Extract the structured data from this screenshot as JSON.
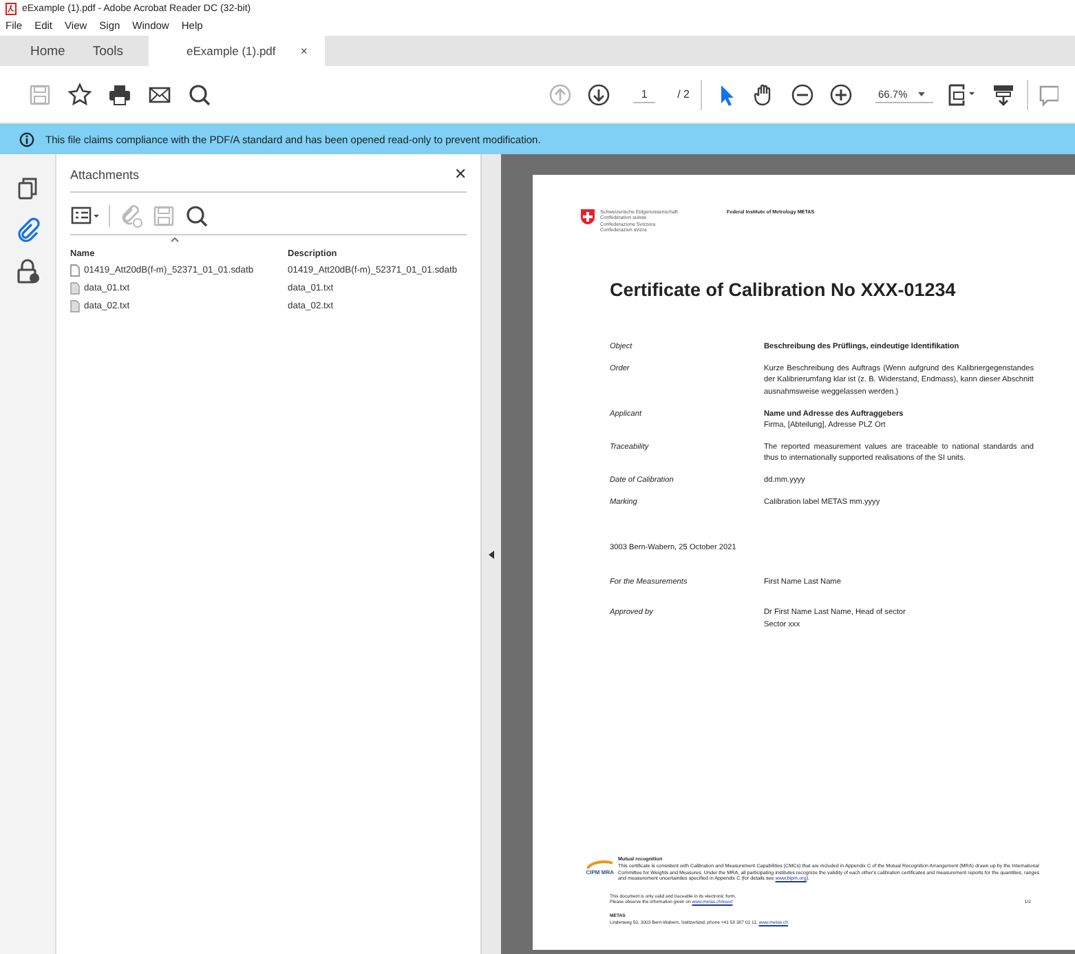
{
  "window": {
    "title": "eExample (1).pdf - Adobe Acrobat Reader DC (32-bit)"
  },
  "menu": [
    "File",
    "Edit",
    "View",
    "Sign",
    "Window",
    "Help"
  ],
  "tabs": [
    {
      "label": "Home",
      "selected": false
    },
    {
      "label": "Tools",
      "selected": false
    },
    {
      "label": "eExample (1).pdf",
      "selected": true,
      "close": "×"
    }
  ],
  "toolbar": {
    "file_tools": [
      {
        "kind": "save",
        "disabled": true
      },
      {
        "kind": "star",
        "disabled": false
      },
      {
        "kind": "print",
        "disabled": false
      },
      {
        "kind": "mail",
        "disabled": false
      },
      {
        "kind": "search",
        "disabled": false
      }
    ],
    "nav_tools": [
      {
        "kind": "up",
        "disabled": true
      },
      {
        "kind": "down",
        "disabled": false
      }
    ],
    "page_field": {
      "value": "1"
    },
    "page_total": "/ 2",
    "view_tools": [
      {
        "kind": "pointer",
        "selected": true
      },
      {
        "kind": "hand",
        "selected": false
      },
      {
        "kind": "zoom-out",
        "selected": false
      },
      {
        "kind": "zoom-in",
        "selected": false
      }
    ],
    "zoom_field": {
      "value": "66.7%"
    }
  },
  "info_bar": {
    "message": "This file claims compliance with the PDF/A standard and has been opened read-only to prevent modification."
  },
  "side_strip": [
    {
      "kind": "pages",
      "selected": false
    },
    {
      "kind": "attachments",
      "selected": true
    },
    {
      "kind": "security",
      "selected": false
    }
  ],
  "attachments": {
    "title": "Attachments",
    "close": "✕",
    "tools": [
      {
        "kind": "list-view",
        "disabled": false
      },
      {
        "kind": "add",
        "disabled": true
      },
      {
        "kind": "save",
        "disabled": true
      },
      {
        "kind": "search",
        "disabled": false
      }
    ],
    "columns": [
      "Name",
      "Description"
    ],
    "rows": [
      {
        "name": "01419_Att20dB(f-m)_52371_01_01.sdatb",
        "description": "01419_Att20dB(f-m)_52371_01_01.sdatb",
        "kind": "generic"
      },
      {
        "name": "data_01.txt",
        "description": "data_01.txt",
        "kind": "text"
      },
      {
        "name": "data_02.txt",
        "description": "data_02.txt",
        "kind": "text"
      }
    ]
  },
  "document": {
    "header": {
      "confederation": [
        "Schweizerische Eidgenossenschaft",
        "Confédération suisse",
        "Confederazione Svizzera",
        "Confederaziun svizra"
      ],
      "institute": "Federal Institute of Metrology METAS"
    },
    "title": "Certificate of Calibration No XXX-01234",
    "fields": [
      {
        "label": "Object",
        "lines": [
          {
            "text": "Beschreibung des Prüflings, eindeutige Identifikation",
            "bold": true
          }
        ]
      },
      {
        "label": "Order",
        "lines": [
          {
            "text": "Kurze Beschreibung des Auftrags (Wenn aufgrund des Kalibriergegenstandes der Kalibrierumfang klar ist (z. B. Widerstand, Endmass), kann dieser Abschnitt ausnahmsweise weggelassen werden.)",
            "bold": false
          }
        ]
      },
      {
        "label": "Applicant",
        "lines": [
          {
            "text": "Name und Adresse des Auftraggebers",
            "bold": true
          },
          {
            "text": "Firma, [Abteilung], Adresse PLZ Ort",
            "bold": false
          }
        ]
      },
      {
        "label": "Traceability",
        "lines": [
          {
            "text": "The reported measurement values are traceable to national standards and thus to internationally supported realisations of the SI units.",
            "bold": false
          }
        ]
      },
      {
        "label": "Date of Calibration",
        "lines": [
          {
            "text": "dd.mm.yyyy",
            "bold": false
          }
        ]
      },
      {
        "label": "Marking",
        "lines": [
          {
            "text": "Calibration label METAS mm.yyyy",
            "bold": false
          }
        ]
      }
    ],
    "place_date": "3003 Bern-Wabern, 25 October 2021",
    "signatures": [
      {
        "label": "For the Measurements",
        "lines": [
          "First Name Last Name"
        ]
      },
      {
        "label": "Approved by",
        "lines": [
          "Dr First Name Last Name, Head of sector",
          "Sector xxx"
        ]
      }
    ],
    "mra": {
      "logo_text": "CIPM MRA",
      "heading": "Mutual recognition",
      "text": "This certificate is consistent with Calibration and Measurement Capabilities (CMCs) that are included in Appendix C of the Mutual Recognition Arrangement (MRA) drawn up by the International Committee for Weights and Measures. Under the MRA, all participating institutes recognize the validity of each other's calibration certificates and measurement reports for the quantities, ranges and measurement uncertainties specified in Appendix C (for details see",
      "link": "www.bipm.org",
      "after": ")."
    },
    "validity": [
      "This document is only valid and traceable in its electronic form.",
      "Please observe the information given on"
    ],
    "validity_link": "www.metas.ch/esort",
    "page_number": "1/2",
    "footer": {
      "org": "METAS",
      "address": "Lindenweg 50, 3003 Bern-Wabern, Switzerland, phone +41 58 387 01 11,",
      "link": "www.metas.ch"
    }
  }
}
